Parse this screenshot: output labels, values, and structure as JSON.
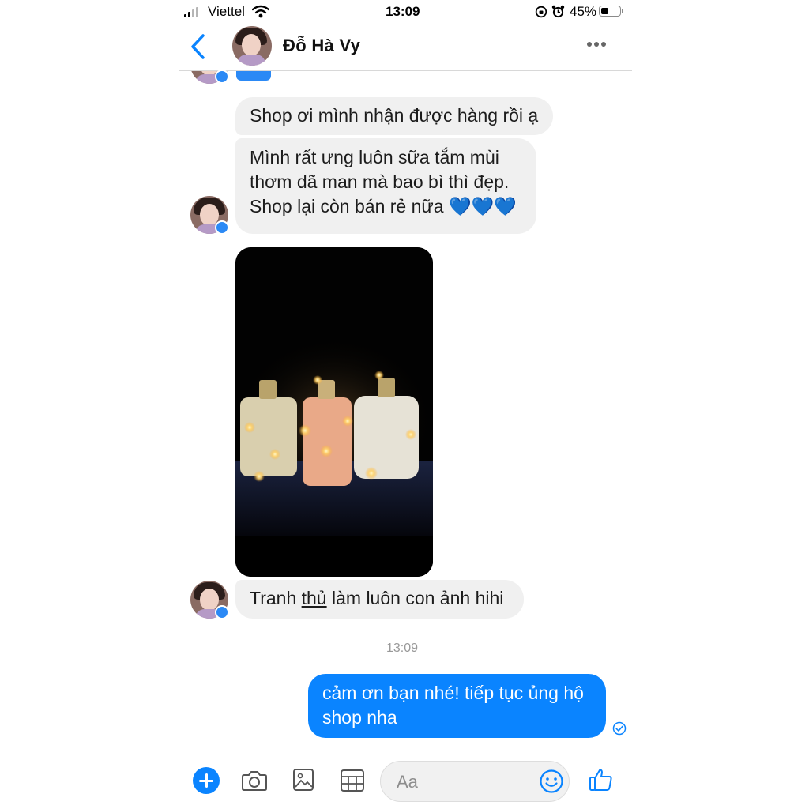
{
  "status_bar": {
    "carrier": "Viettel",
    "time": "13:09",
    "battery": "45%",
    "battery_level": 0.45
  },
  "header": {
    "back_icon": "chevron-left-icon",
    "contact_name": "Đỗ Hà Vy",
    "more_icon": "more-dots-icon"
  },
  "messages": {
    "in_1": "Shop ơi mình nhận được hàng rồi ạ",
    "in_2_line1": "Mình rất ưng luôn sữa tắm mùi",
    "in_2_line2": "thơm dã man mà bao bì thì đẹp.",
    "in_2_line3": "Shop lại còn bán rẻ nữa",
    "in_2_emoji": "💙💙💙",
    "in_3_pre": "Tranh ",
    "in_3_underlined": "thủ",
    "in_3_post": " làm luôn con ảnh hihi",
    "timestamp": "13:09",
    "out_1_line1": "cảm ơn bạn nhé! tiếp tục ủng hộ",
    "out_1_line2": "shop nha"
  },
  "composer": {
    "placeholder": "Aa",
    "icons": [
      "plus-icon",
      "camera-icon",
      "gallery-icon",
      "gif-grid-icon",
      "emoji-icon",
      "like-icon"
    ]
  },
  "colors": {
    "accent": "#0a84ff",
    "incoming_bubble": "#f0f0f0",
    "badge": "#2b89f5"
  }
}
